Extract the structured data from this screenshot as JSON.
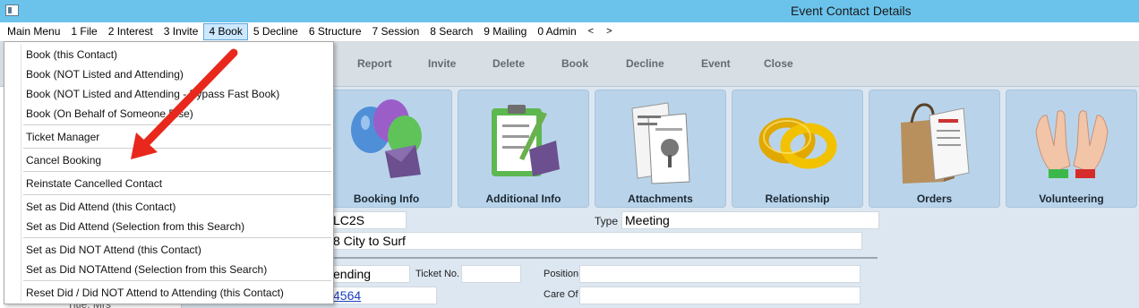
{
  "window": {
    "title": "Event Contact Details"
  },
  "menubar": {
    "items": [
      "Main Menu",
      "1 File",
      "2 Interest",
      "3 Invite",
      "4 Book",
      "5 Decline",
      "6 Structure",
      "7 Session",
      "8 Search",
      "9 Mailing",
      "0 Admin"
    ],
    "prev": "<",
    "next": ">"
  },
  "toolbar": {
    "report": "Report",
    "invite": "Invite",
    "delete": "Delete",
    "book": "Book",
    "decline": "Decline",
    "event": "Event",
    "close": "Close"
  },
  "tiles": {
    "booking_info": "Booking Info",
    "additional_info": "Additional Info",
    "attachments": "Attachments",
    "relationship": "Relationship",
    "orders": "Orders",
    "volunteering": "Volunteering"
  },
  "form": {
    "code_value": "LC2S",
    "type_label": "Type",
    "type_value": "Meeting",
    "event_name_value": "8 City to Surf",
    "status_value": "ending",
    "ticket_label": "Ticket No.",
    "ticket_value": "",
    "position_label": "Position",
    "position_value": "",
    "link_value": "4564",
    "care_of_label": "Care Of",
    "care_of_value": ""
  },
  "leftpane": {
    "partial_text": "Title: Mrs"
  },
  "book_menu": {
    "book_this": "Book (this Contact)",
    "book_not_listed": "Book (NOT Listed and Attending)",
    "book_not_listed_bypass": "Book (NOT Listed and Attending - Bypass Fast Book)",
    "book_on_behalf": "Book (On Behalf of Someone Else)",
    "ticket_manager": "Ticket Manager",
    "cancel_booking": "Cancel Booking",
    "reinstate": "Reinstate Cancelled Contact",
    "did_attend_this": "Set as Did Attend (this Contact)",
    "did_attend_selection": "Set as Did Attend (Selection from this Search)",
    "did_not_attend_this": "Set as Did NOT Attend (this Contact)",
    "did_not_attend_selection": "Set as Did NOTAttend (Selection from this Search)",
    "reset": "Reset Did / Did NOT Attend to Attending (this Contact)"
  },
  "colors": {
    "titlebar": "#6bc3ec",
    "tile": "#b9d4ea",
    "arrow": "#e8281c",
    "menu_highlight": "#cce8ff"
  }
}
